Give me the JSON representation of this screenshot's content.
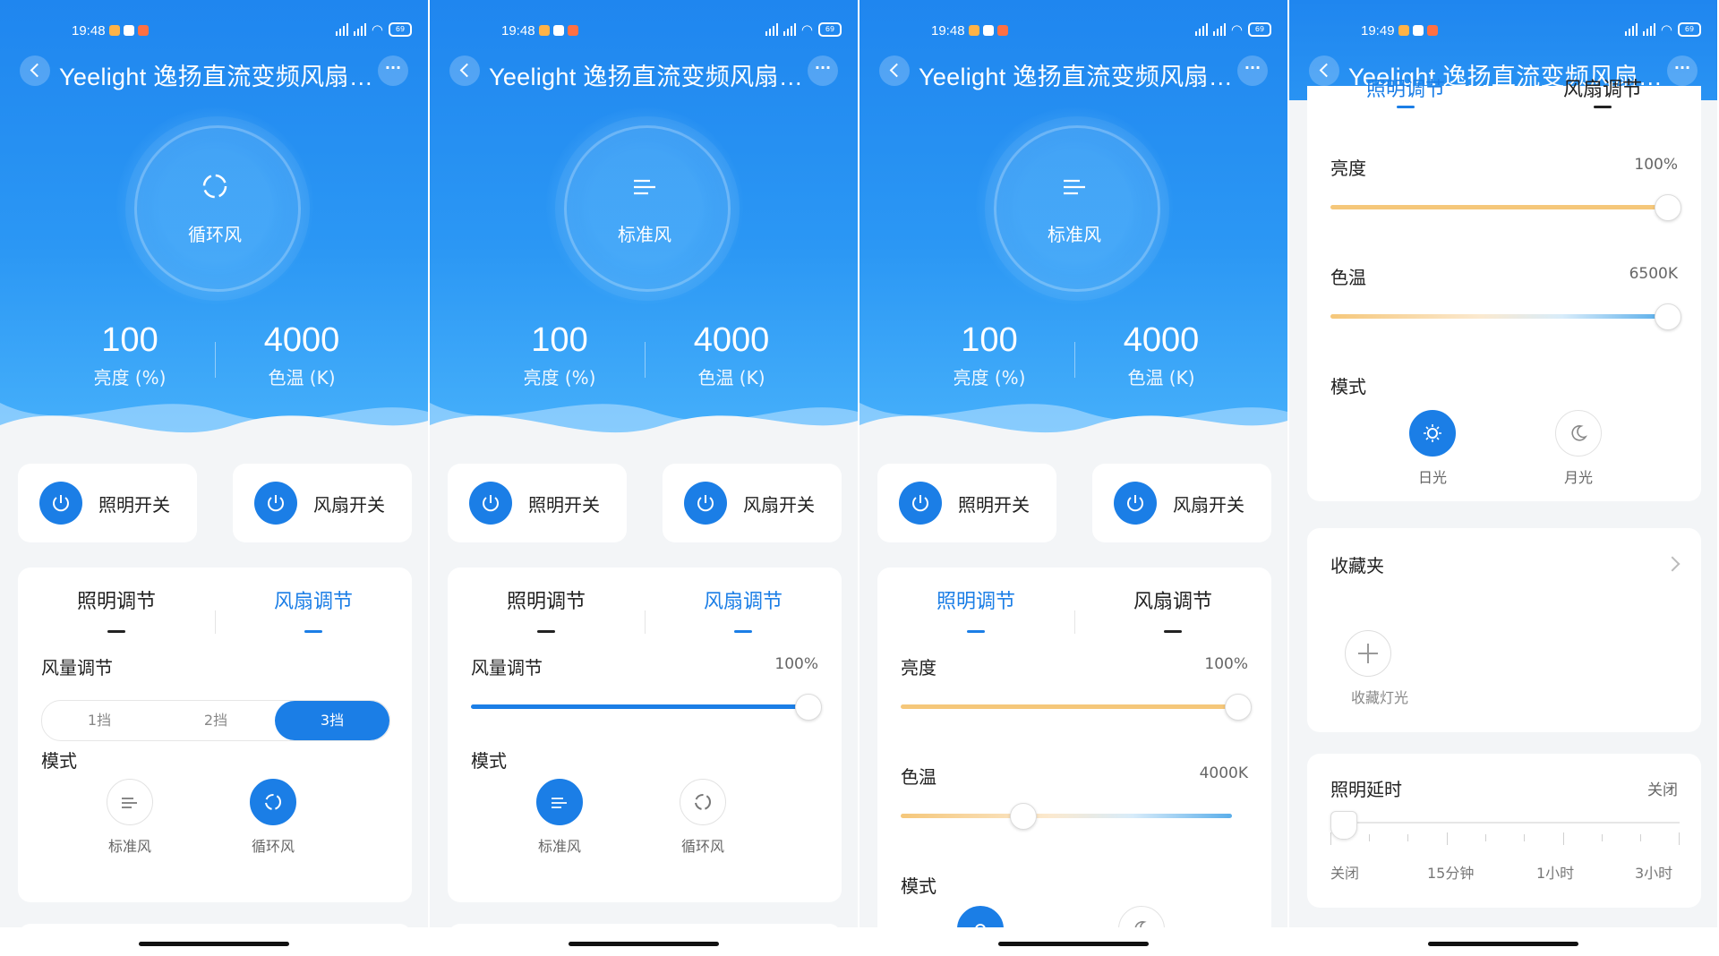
{
  "status": {
    "time_a": "19:48",
    "time_b": "19:49",
    "battery": "69"
  },
  "nav": {
    "title": "Yeelight 逸扬直流变频风扇…",
    "more": "···"
  },
  "stats": {
    "brightness_value": "100",
    "brightness_label": "亮度 (%)",
    "ct_value": "4000",
    "ct_label": "色温 (K)"
  },
  "panels": [
    {
      "ring_label": "循环风",
      "mode": "cycle"
    },
    {
      "ring_label": "标准风",
      "mode": "standard"
    },
    {
      "ring_label": "标准风",
      "mode": "standard"
    }
  ],
  "switches": {
    "light": "照明开关",
    "fan": "风扇开关"
  },
  "tabs": {
    "light": "照明调节",
    "fan": "风扇调节"
  },
  "fan_ctrl": {
    "volume_label": "风量调节",
    "volume_value": "100%",
    "gears": [
      "1挡",
      "2挡",
      "3挡"
    ],
    "active_gear_index": 2,
    "mode_label": "模式",
    "modes": [
      "标准风",
      "循环风"
    ],
    "slider_level": 1.0
  },
  "light_ctrl": {
    "brightness_label": "亮度",
    "brightness_value": "100%",
    "brightness_level": 1.0,
    "ct_label": "色温",
    "ct_value_p3": "4000K",
    "ct_level_p3": 0.35,
    "ct_value_p4": "6500K",
    "ct_level_p4": 1.0,
    "mode_label": "模式",
    "modes": [
      "日光",
      "月光"
    ]
  },
  "favorites": {
    "title": "收藏夹",
    "add_label": "收藏灯光"
  },
  "delay": {
    "title": "照明延时",
    "value": "关闭",
    "marks": [
      "关闭",
      "15分钟",
      "1小时",
      "3小时"
    ]
  },
  "colors": {
    "primary": "#1b7ee6",
    "hero_top": "#1f86ef",
    "warm": "#f5c77a",
    "cool": "#5aaeea"
  }
}
